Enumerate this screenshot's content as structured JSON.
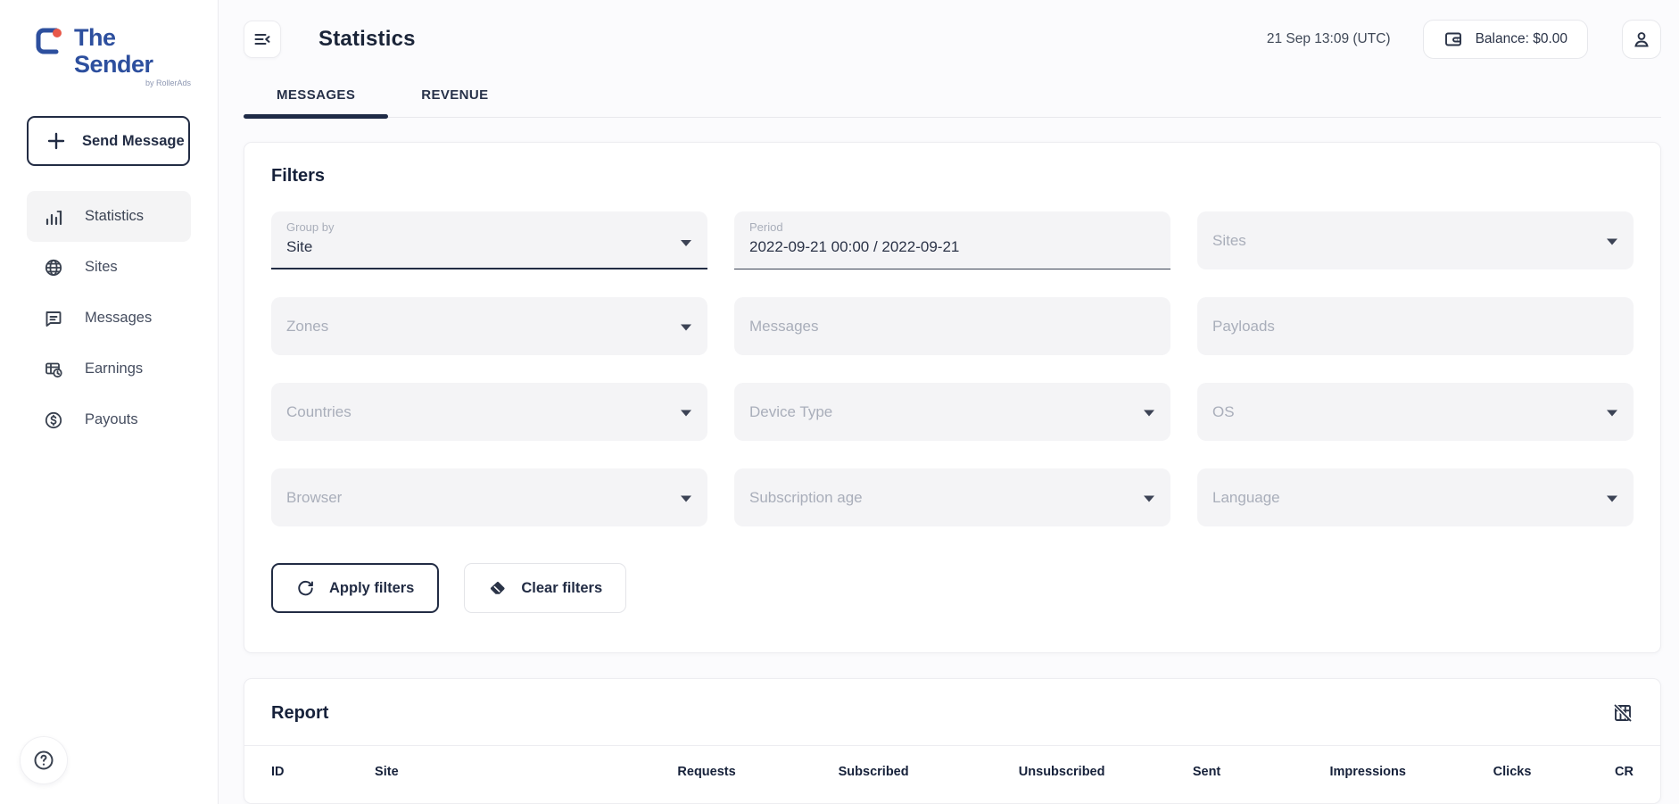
{
  "sidebar": {
    "logo": {
      "title": "The Sender",
      "subtitle": "by RollerAds"
    },
    "send_message_label": "Send Message",
    "items": [
      {
        "label": "Statistics",
        "icon": "bar-chart-icon",
        "active": true
      },
      {
        "label": "Sites",
        "icon": "globe-icon",
        "active": false
      },
      {
        "label": "Messages",
        "icon": "chat-icon",
        "active": false
      },
      {
        "label": "Earnings",
        "icon": "earnings-icon",
        "active": false
      },
      {
        "label": "Payouts",
        "icon": "payouts-icon",
        "active": false
      }
    ]
  },
  "header": {
    "title": "Statistics",
    "datetime": "21 Sep 13:09 (UTC)",
    "balance_label": "Balance: $0.00"
  },
  "tabs": [
    {
      "label": "MESSAGES",
      "active": true
    },
    {
      "label": "REVENUE",
      "active": false
    }
  ],
  "filters": {
    "heading": "Filters",
    "fields": [
      {
        "label": "Group by",
        "value": "Site"
      },
      {
        "label": "Period",
        "value": "2022-09-21 00:00 / 2022-09-21"
      },
      {
        "label": "Sites"
      },
      {
        "label": "Zones"
      },
      {
        "label": "Messages"
      },
      {
        "label": "Payloads"
      },
      {
        "label": "Countries"
      },
      {
        "label": "Device Type"
      },
      {
        "label": "OS"
      },
      {
        "label": "Browser"
      },
      {
        "label": "Subscription age"
      },
      {
        "label": "Language"
      }
    ],
    "apply_label": "Apply filters",
    "clear_label": "Clear filters"
  },
  "report": {
    "heading": "Report",
    "columns": [
      "ID",
      "Site",
      "Requests",
      "Subscribed",
      "Unsubscribed",
      "Sent",
      "Impressions",
      "Clicks",
      "CR"
    ]
  },
  "colors": {
    "accent_navy": "#222c44",
    "logo_blue": "#2d4f9e",
    "logo_red": "#e8594a",
    "field_bg": "#f4f4f6",
    "placeholder": "#a9aeba"
  }
}
